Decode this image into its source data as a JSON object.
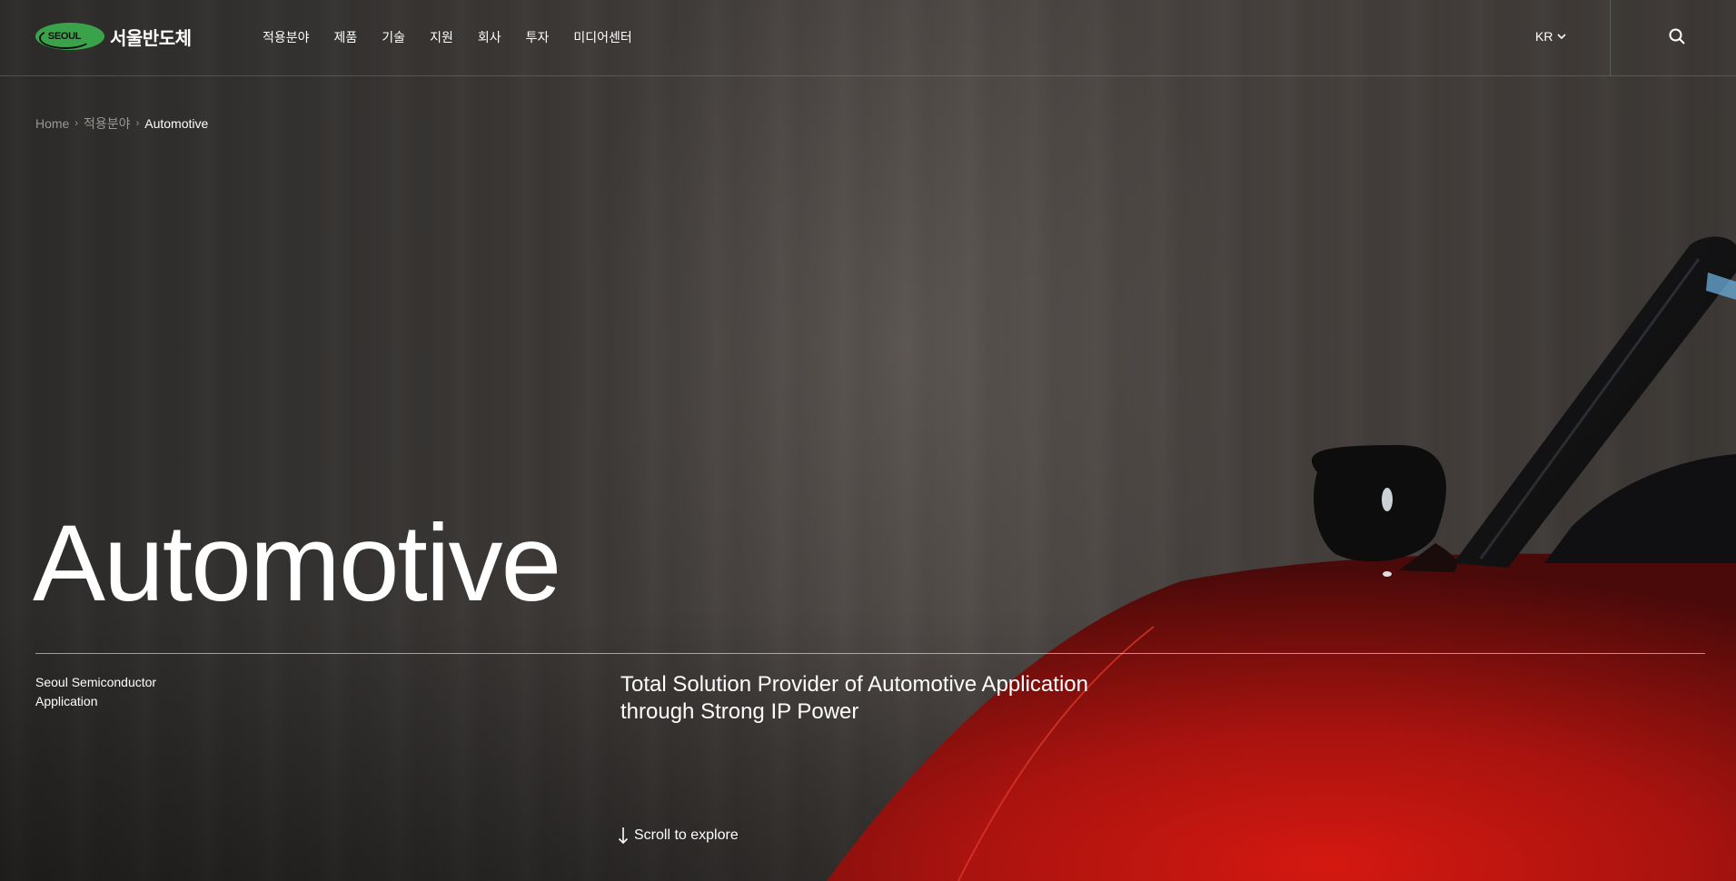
{
  "header": {
    "logo_mark": "SEOUL",
    "logo_text": "서울반도체",
    "nav": [
      "적용분야",
      "제품",
      "기술",
      "지원",
      "회사",
      "투자",
      "미디어센터"
    ],
    "language": "KR"
  },
  "breadcrumb": {
    "home": "Home",
    "parent": "적용분야",
    "current": "Automotive"
  },
  "hero": {
    "title": "Automotive",
    "subtitle": "Seoul Semiconductor Application",
    "tagline": "Total Solution Provider of Automotive Application through Strong IP Power",
    "scroll_label": "Scroll to explore"
  },
  "icons": {
    "logo": "seoul-logo-icon",
    "language_caret": "chevron-down-icon",
    "search": "search-icon",
    "scroll": "arrow-down-icon",
    "breadcrumb_separator": "chevron-right-icon"
  },
  "colors": {
    "brand_green": "#3aa34a",
    "car_red": "#b11512",
    "background": "#3f3b38"
  }
}
